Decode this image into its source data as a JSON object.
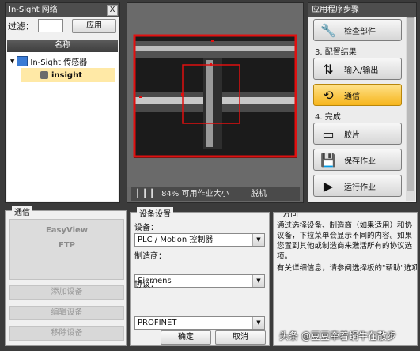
{
  "network_panel": {
    "title": "In-Sight 网络",
    "close": "X",
    "filter_label": "过滤：",
    "filter_value": "",
    "apply_label": "应用",
    "column_header": "名称",
    "tree": [
      {
        "label": "In-Sight 传感器",
        "expander": "▲"
      },
      {
        "label": "insight"
      }
    ]
  },
  "image_view": {
    "status_text": "84% 可用作业大小",
    "mode_text": "脱机"
  },
  "steps_panel": {
    "title": "应用程序步骤",
    "items": [
      {
        "type": "button",
        "label": "检查部件",
        "icon": "wrench-icon"
      },
      {
        "type": "header",
        "label": "3. 配置结果"
      },
      {
        "type": "button",
        "label": "输入/输出",
        "icon": "io-icon"
      },
      {
        "type": "button",
        "label": "通信",
        "icon": "communication-icon",
        "active": true
      },
      {
        "type": "header",
        "label": "4. 完成"
      },
      {
        "type": "button",
        "label": "胶片",
        "icon": "filmstrip-icon"
      },
      {
        "type": "button",
        "label": "保存作业",
        "icon": "save-icon"
      },
      {
        "type": "button",
        "label": "运行作业",
        "icon": "play-icon"
      }
    ]
  },
  "comm_panel": {
    "title": "通信",
    "list": [
      "EasyView",
      "FTP"
    ],
    "add_label": "添加设备",
    "edit_label": "编辑设备",
    "remove_label": "移除设备"
  },
  "device_settings": {
    "title": "设备设置",
    "device_label": "设备：",
    "device_value": "PLC / Motion 控制器",
    "manufacturer_label": "制造商：",
    "manufacturer_value": "Siemens",
    "protocol_label": "协议：",
    "protocol_value": "PROFINET",
    "ok_label": "确定",
    "cancel_label": "取消"
  },
  "direction_panel": {
    "title": "方向",
    "paragraph1": "通过选择设备、制造商（如果适用）和协议备，下拉菜单会显示不同的内容。如果您置到其他或制造商来激活所有的协议选项。",
    "paragraph2": "有关详细信息，请参阅选择板的\"帮助\"选项"
  },
  "watermark": "头条 @豆豆牵着蜗牛在散步",
  "colors": {
    "accent_active": "#f6b51c",
    "roi_red": "#e01010"
  }
}
